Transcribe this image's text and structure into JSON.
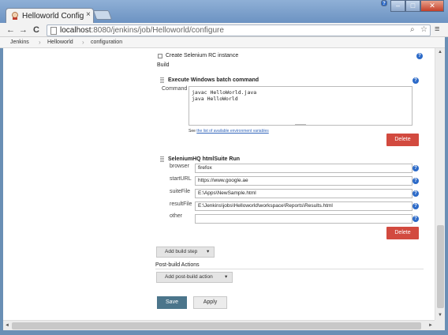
{
  "browser": {
    "tab_title": "Helloworld Config [Je",
    "tab_close": "×",
    "window_help": "?",
    "window_min": "–",
    "window_max": "□",
    "window_close": "✕",
    "url_host": "localhost",
    "url_path": ":8080/jenkins/job/Helloworld/configure",
    "back_icon": "←",
    "forward_icon": "→",
    "reload_icon": "C",
    "search_icon": "⌕",
    "star_icon": "☆",
    "menu_icon": "≡"
  },
  "breadcrumbs": {
    "items": [
      "Jenkins",
      "Helloworld",
      "configuration"
    ],
    "separator": "›"
  },
  "page": {
    "selenium_rc_label": "Create Selenium RC instance",
    "build_heading": "Build",
    "batch": {
      "title": "Execute Windows batch command",
      "command_label": "Command",
      "command_lines": [
        "javac HelloWorld.java",
        "java HelloWorld"
      ],
      "env_note_prefix": "See ",
      "env_note_link": "the list of available environment variables",
      "delete_label": "Delete"
    },
    "selenium": {
      "title": "SeleniumHQ htmlSuite Run",
      "fields": [
        {
          "label": "browser",
          "value": "firefox"
        },
        {
          "label": "startURL",
          "value": "https://www.google.ae"
        },
        {
          "label": "suiteFile",
          "value": "E:\\Apps\\NewSample.html"
        },
        {
          "label": "resultFile",
          "value": "E:\\Jenkins\\jobs\\Helloworld\\workspace\\Reports\\Results.html"
        },
        {
          "label": "other",
          "value": ""
        }
      ],
      "delete_label": "Delete"
    },
    "add_build_step_label": "Add build step",
    "post_build_heading": "Post-build Actions",
    "add_post_build_label": "Add post-build action",
    "dropdown_arrow": "▾",
    "help_glyph": "?",
    "save_label": "Save",
    "apply_label": "Apply"
  },
  "scrollbars": {
    "up_arrow": "▲",
    "down_arrow": "▼",
    "left_arrow": "◄",
    "right_arrow": "►"
  }
}
